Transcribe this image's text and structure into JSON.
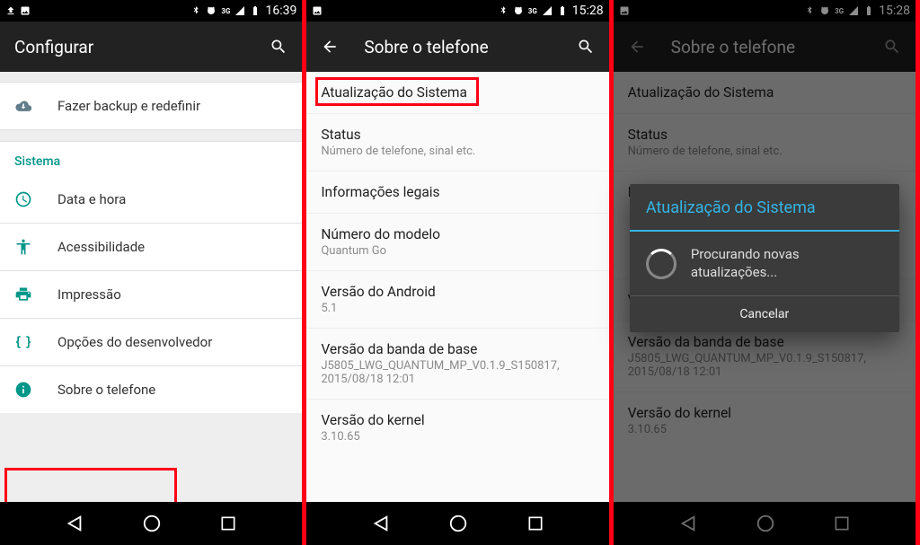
{
  "screen1": {
    "statusbar": {
      "time": "16:39",
      "net": "3G"
    },
    "appbar": {
      "title": "Configurar"
    },
    "items": {
      "backup": "Fazer backup e redefinir",
      "section": "Sistema",
      "date": "Data e hora",
      "access": "Acessibilidade",
      "print": "Impressão",
      "dev": "Opções do desenvolvedor",
      "about": "Sobre o telefone"
    }
  },
  "screen2": {
    "statusbar": {
      "time": "15:28",
      "net": "3G"
    },
    "appbar": {
      "title": "Sobre o telefone"
    },
    "entries": {
      "update": {
        "title": "Atualização do Sistema"
      },
      "status": {
        "title": "Status",
        "subtitle": "Número de telefone, sinal etc."
      },
      "legal": {
        "title": "Informações legais"
      },
      "model": {
        "title": "Número do modelo",
        "subtitle": "Quantum Go"
      },
      "android": {
        "title": "Versão do Android",
        "subtitle": "5.1"
      },
      "baseband": {
        "title": "Versão da banda de base",
        "subtitle": "J5805_LWG_QUANTUM_MP_V0.1.9_S150817, 2015/08/18 12:01"
      },
      "kernel": {
        "title": "Versão do kernel",
        "subtitle": "3.10.65"
      }
    }
  },
  "screen3": {
    "statusbar": {
      "time": "15:28",
      "net": "3G"
    },
    "appbar": {
      "title": "Sobre o telefone"
    },
    "entries": {
      "update": {
        "title": "Atualização do Sistema"
      },
      "status": {
        "title": "Status",
        "subtitle": "Número de telefone, sinal etc."
      },
      "legal_initial": "I",
      "baseband": {
        "title": "Versão da banda de base",
        "subtitle": "J5805_LWG_QUANTUM_MP_V0.1.9_S150817, 2015/08/18 12:01"
      },
      "kernel": {
        "title": "Versão do kernel",
        "subtitle": "3.10.65"
      },
      "v_initial": "V"
    },
    "dialog": {
      "title": "Atualização do Sistema",
      "message": "Procurando novas atualizações...",
      "cancel": "Cancelar"
    }
  }
}
